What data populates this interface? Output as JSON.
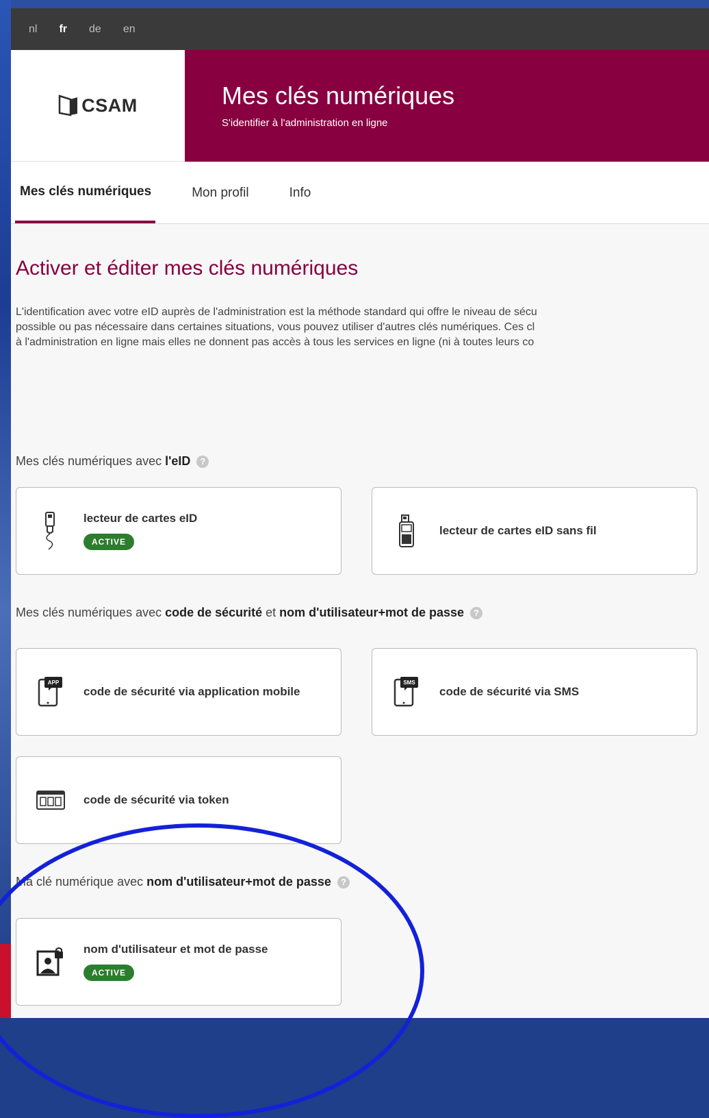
{
  "languages": [
    {
      "code": "nl",
      "active": false
    },
    {
      "code": "fr",
      "active": true
    },
    {
      "code": "de",
      "active": false
    },
    {
      "code": "en",
      "active": false
    }
  ],
  "logo": {
    "text": "CSAM"
  },
  "brand": {
    "title": "Mes clés numériques",
    "subtitle": "S'identifier à l'administration en ligne",
    "color": "#880040"
  },
  "tabs": [
    {
      "label": "Mes clés numériques",
      "active": true
    },
    {
      "label": "Mon profil",
      "active": false
    },
    {
      "label": "Info",
      "active": false
    }
  ],
  "section_title": "Activer et éditer mes clés numériques",
  "intro": [
    "L'identification avec votre eID auprès de l'administration est la méthode standard qui offre le niveau de sécu",
    "possible ou pas nécessaire dans certaines situations, vous pouvez utiliser d'autres clés numériques. Ces cl",
    "à l'administration en ligne mais elles ne donnent pas accès à tous les services en ligne (ni à toutes leurs co"
  ],
  "groups": {
    "eid": {
      "prefix": "Mes clés numériques avec ",
      "bold1": "l'eID"
    },
    "code": {
      "prefix": "Mes clés numériques avec ",
      "bold1": "code de sécurité",
      "middle": " et ",
      "bold2": "nom d'utilisateur+mot de passe"
    },
    "password": {
      "prefix": "Ma clé numérique avec ",
      "bold1": "nom d'utilisateur+mot de passe"
    }
  },
  "cards": {
    "eid_reader": {
      "label": "lecteur de cartes eID",
      "badge": "ACTIVE",
      "icon": "card-reader-icon"
    },
    "eid_wireless": {
      "label": "lecteur de cartes eID sans fil",
      "icon": "wireless-card-reader-icon"
    },
    "mobile_app": {
      "label": "code de sécurité via application mobile",
      "icon": "mobile-app-icon",
      "icon_text": "APP"
    },
    "sms": {
      "label": "code de sécurité via SMS",
      "icon": "sms-icon",
      "icon_text": "SMS"
    },
    "token": {
      "label": "code de sécurité via token",
      "icon": "token-icon"
    },
    "password": {
      "label": "nom d'utilisateur et mot de passe",
      "badge": "ACTIVE",
      "icon": "user-lock-icon"
    }
  },
  "help_symbol": "?",
  "colors": {
    "active_badge": "#2d7d2f",
    "annotation": "#1322d8"
  }
}
